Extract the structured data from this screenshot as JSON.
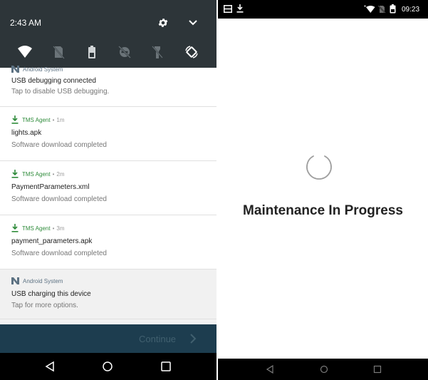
{
  "left": {
    "quick_settings": {
      "time": "2:43 AM",
      "icons": [
        "gear-icon",
        "chevron-down-icon",
        "wifi-icon",
        "no-sim-icon",
        "battery-icon",
        "do-not-disturb-icon",
        "flashlight-icon",
        "auto-rotate-icon"
      ]
    },
    "notifications": [
      {
        "partial_app": "Android System",
        "title": "USB debugging connected",
        "subtitle": "Tap to disable USB debugging."
      },
      {
        "app": "TMS Agent",
        "separator": "•",
        "age": "1m",
        "title": "lights.apk",
        "subtitle": "Software download completed"
      },
      {
        "app": "TMS Agent",
        "separator": "•",
        "age": "2m",
        "title": "PaymentParameters.xml",
        "subtitle": "Software download completed"
      },
      {
        "app": "TMS Agent",
        "separator": "•",
        "age": "3m",
        "title": "payment_parameters.apk",
        "subtitle": "Software download completed"
      },
      {
        "app": "Android System",
        "title": "USB charging this device",
        "subtitle": "Tap for more options."
      }
    ],
    "continue_label": "Continue",
    "colors": {
      "download_green": "#2e8b3a",
      "continue_bar": "#1d3d4f",
      "qs_bg": "#2d3539"
    }
  },
  "right": {
    "status_time": "09:23",
    "message": "Maintenance In Progress",
    "icons": [
      "screen-icon",
      "download-icon",
      "wifi-icon",
      "no-sim-icon",
      "battery-icon"
    ]
  }
}
